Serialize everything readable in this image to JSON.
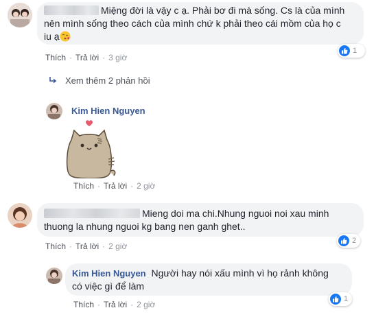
{
  "colors": {
    "bubble_bg": "#f2f3f5",
    "name_color": "#385898",
    "like_blue": "#1877f2",
    "meta_text": "#90949c"
  },
  "comments": [
    {
      "name": "",
      "text_lines": [
        "Miệng đời là vậy c ạ. Phải bơ đi mà sống. Cs là của mình",
        "nên mình sống theo cách của mình chứ k phải theo cái mồm của họ c",
        "iu ạ"
      ],
      "emoji": "kissing-face-icon",
      "actions": {
        "like": "Thích",
        "reply": "Trả lời",
        "time": "3 giờ"
      },
      "reaction_count": "1",
      "view_more": "Xem thêm 2 phản hồi",
      "reply": {
        "name": "Kim Hien Nguyen",
        "sticker": "pusheen-cat-heart-sticker",
        "actions": {
          "like": "Thích",
          "reply": "Trả lời",
          "time": "2 giờ"
        }
      }
    },
    {
      "name": "",
      "text_lines": [
        "Mieng doi ma chi.Nhung nguoi noi xau minh",
        "thuong la nhung nguoi kg bang nen ganh ghet.."
      ],
      "actions": {
        "like": "Thích",
        "reply": "Trả lời",
        "time": "2 giờ"
      },
      "reaction_count": "2",
      "reply": {
        "name": "Kim Hien Nguyen",
        "text_lines": [
          "Người hay nói xấu mình vì họ rảnh không",
          "có việc gì để làm"
        ],
        "actions": {
          "like": "Thích",
          "reply": "Trả lời",
          "time": "2 giờ"
        },
        "reaction_count": "1"
      }
    }
  ]
}
